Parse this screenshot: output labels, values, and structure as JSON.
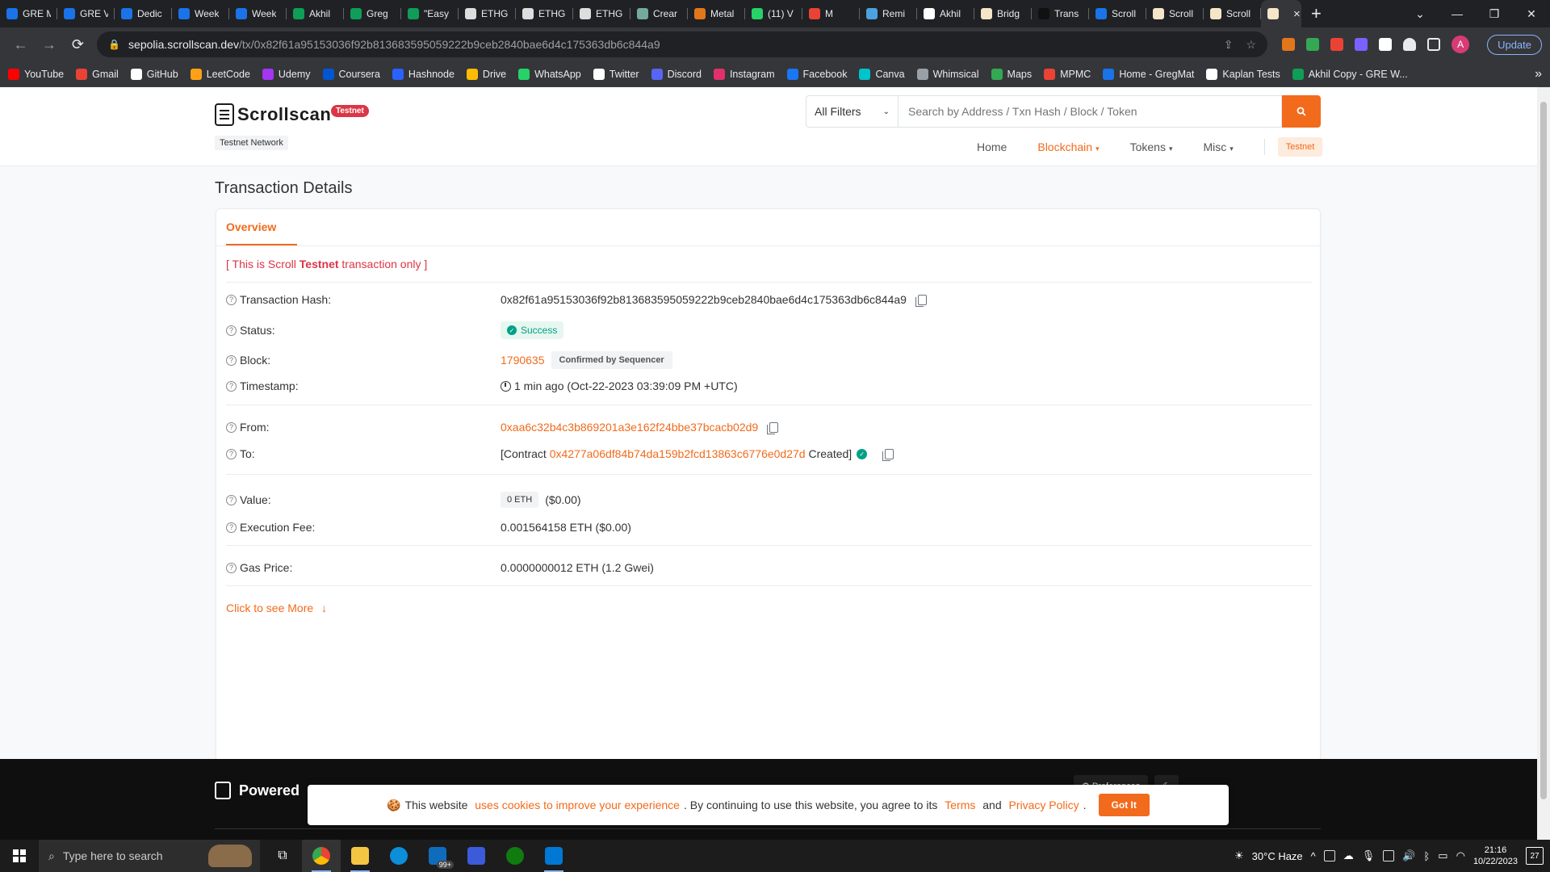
{
  "browser": {
    "tabs": [
      {
        "title": "GRE M",
        "color": "#1a73e8"
      },
      {
        "title": "GRE V",
        "color": "#1a73e8"
      },
      {
        "title": "Dedic",
        "color": "#1a73e8"
      },
      {
        "title": "Week",
        "color": "#1a73e8"
      },
      {
        "title": "Week",
        "color": "#1a73e8"
      },
      {
        "title": "Akhil",
        "color": "#0f9d58"
      },
      {
        "title": "Greg",
        "color": "#0f9d58"
      },
      {
        "title": "\"Easy",
        "color": "#0f9d58"
      },
      {
        "title": "ETHG",
        "color": "#dddddd"
      },
      {
        "title": "ETHG",
        "color": "#dddddd"
      },
      {
        "title": "ETHG",
        "color": "#dddddd"
      },
      {
        "title": "Crear",
        "color": "#74aa9c"
      },
      {
        "title": "Metal",
        "color": "#e2761b"
      },
      {
        "title": "(11) V",
        "color": "#25d366"
      },
      {
        "title": "M",
        "color": "#ea4335"
      },
      {
        "title": "Remi",
        "color": "#4aa3df"
      },
      {
        "title": "Akhil",
        "color": "#ffffff"
      },
      {
        "title": "Bridg",
        "color": "#f5e6c8"
      },
      {
        "title": "Trans",
        "color": "#111111"
      },
      {
        "title": "Scroll",
        "color": "#1a73e8"
      },
      {
        "title": "Scroll",
        "color": "#f5e6c8"
      },
      {
        "title": "Scroll",
        "color": "#f5e6c8"
      }
    ],
    "active_tab": {
      "title": "S",
      "color": "#f5e6c8"
    },
    "url_host": "sepolia.scrollscan.dev",
    "url_path": "/tx/0x82f61a95153036f92b813683595059222b9ceb2840bae6d4c175363db6c844a9",
    "update_label": "Update",
    "profile_initial": "A",
    "bookmarks": [
      {
        "label": "YouTube",
        "color": "#ff0000"
      },
      {
        "label": "Gmail",
        "color": "#ea4335"
      },
      {
        "label": "GitHub",
        "color": "#ffffff"
      },
      {
        "label": "LeetCode",
        "color": "#ffa116"
      },
      {
        "label": "Udemy",
        "color": "#a435f0"
      },
      {
        "label": "Coursera",
        "color": "#0056d2"
      },
      {
        "label": "Hashnode",
        "color": "#2962ff"
      },
      {
        "label": "Drive",
        "color": "#fbbc04"
      },
      {
        "label": "WhatsApp",
        "color": "#25d366"
      },
      {
        "label": "Twitter",
        "color": "#ffffff"
      },
      {
        "label": "Discord",
        "color": "#5865f2"
      },
      {
        "label": "Instagram",
        "color": "#e1306c"
      },
      {
        "label": "Facebook",
        "color": "#1877f2"
      },
      {
        "label": "Canva",
        "color": "#00c4cc"
      },
      {
        "label": "Whimsical",
        "color": "#9aa0a6"
      },
      {
        "label": "Maps",
        "color": "#34a853"
      },
      {
        "label": "MPMC",
        "color": "#ea4335"
      },
      {
        "label": "Home - GregMat",
        "color": "#1a73e8"
      },
      {
        "label": "Kaplan Tests",
        "color": "#ffffff"
      },
      {
        "label": "Akhil Copy - GRE W...",
        "color": "#0f9d58"
      }
    ]
  },
  "site": {
    "logo": "Scrollscan",
    "testnet_pill": "Testnet",
    "network_tag": "Testnet Network",
    "filter_label": "All Filters",
    "search_placeholder": "Search by Address / Txn Hash / Block / Token",
    "nav": {
      "home": "Home",
      "blockchain": "Blockchain",
      "tokens": "Tokens",
      "misc": "Misc",
      "testnet": "Testnet"
    }
  },
  "tx": {
    "page_title": "Transaction Details",
    "tab_overview": "Overview",
    "notice_prefix": "[ This is Scroll ",
    "notice_bold": "Testnet",
    "notice_suffix": " transaction only ]",
    "labels": {
      "hash": "Transaction Hash:",
      "status": "Status:",
      "block": "Block:",
      "timestamp": "Timestamp:",
      "from": "From:",
      "to": "To:",
      "value": "Value:",
      "fee": "Execution Fee:",
      "gas": "Gas Price:"
    },
    "hash": "0x82f61a95153036f92b813683595059222b9ceb2840bae6d4c175363db6c844a9",
    "status": "Success",
    "block": "1790635",
    "block_badge": "Confirmed by Sequencer",
    "timestamp": "1 min ago (Oct-22-2023 03:39:09 PM +UTC)",
    "from": "0xaa6c32b4c3b869201a3e162f24bbe37bcacb02d9",
    "to_prefix": "[Contract ",
    "to_address": "0x4277a06df84b74da159b2fcd13863c6776e0d27d",
    "to_suffix": " Created]",
    "value_badge": "0 ETH",
    "value_usd": "($0.00)",
    "fee": "0.001564158 ETH ($0.00)",
    "gas": "0.0000000012 ETH (1.2 Gwei)",
    "see_more": "Click to see More"
  },
  "footer": {
    "powered": "Powered",
    "preferences": "Preferences"
  },
  "cookie": {
    "text1": "This website ",
    "link1": "uses cookies to improve your experience",
    "text2": ". By continuing to use this website, you agree to its ",
    "terms": "Terms",
    "and": " and ",
    "privacy": "Privacy Policy",
    "period": ".",
    "button": "Got It"
  },
  "taskbar": {
    "search_placeholder": "Type here to search",
    "weather": "30°C  Haze",
    "time": "21:16",
    "date": "10/22/2023",
    "notifications": "27",
    "mail_badge": "99+"
  },
  "colors": {
    "accent": "#f26a1b",
    "success": "#00a186",
    "danger": "#dc3545"
  }
}
